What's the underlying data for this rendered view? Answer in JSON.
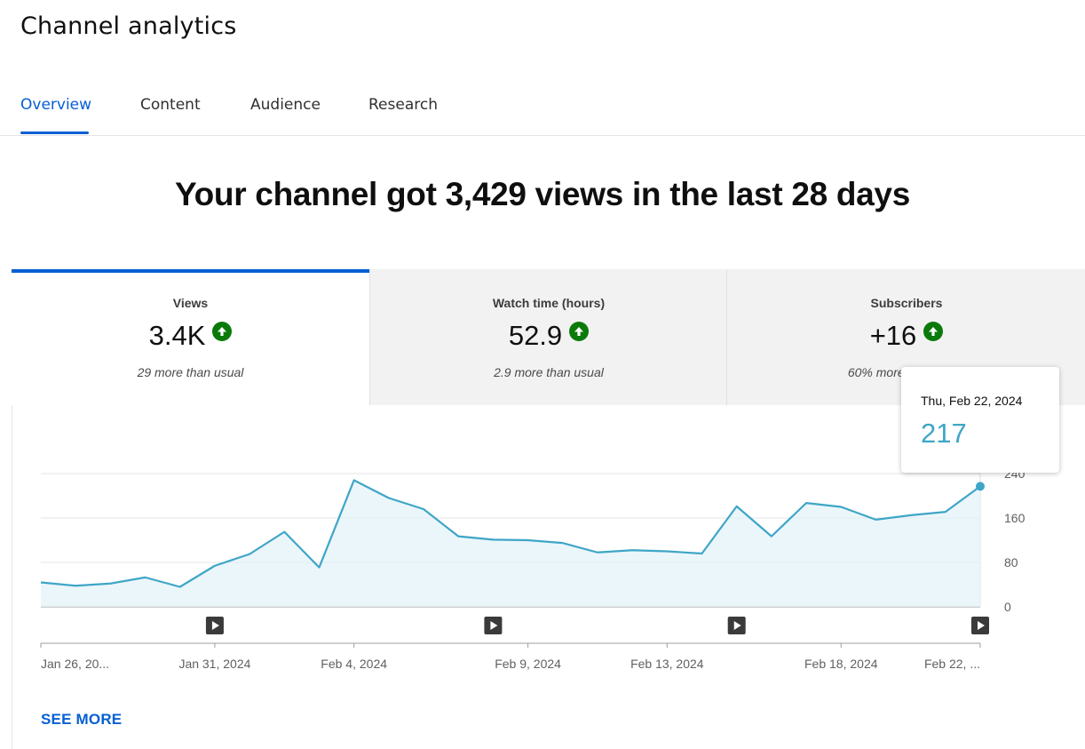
{
  "page": {
    "title": "Channel analytics"
  },
  "tabs": [
    {
      "label": "Overview",
      "active": true
    },
    {
      "label": "Content"
    },
    {
      "label": "Audience"
    },
    {
      "label": "Research"
    }
  ],
  "headline": "Your channel got 3,429 views in the last 28 days",
  "metrics": [
    {
      "label": "Views",
      "value": "3.4K",
      "note": "29 more than usual",
      "trend": "up",
      "selected": true
    },
    {
      "label": "Watch time (hours)",
      "value": "52.9",
      "note": "2.9 more than usual",
      "trend": "up"
    },
    {
      "label": "Subscribers",
      "value": "+16",
      "note": "60% more than usual",
      "trend": "up"
    }
  ],
  "tooltip": {
    "date": "Thu, Feb 22, 2024",
    "value": "217"
  },
  "see_more": "SEE MORE",
  "colors": {
    "accent": "#065fd4",
    "line": "#3ea6c7",
    "fill": "#e3f2f9",
    "trend_up": "#0b7a0b"
  },
  "chart_data": {
    "type": "area",
    "x": [
      "2024-01-26",
      "2024-01-27",
      "2024-01-28",
      "2024-01-29",
      "2024-01-30",
      "2024-01-31",
      "2024-02-01",
      "2024-02-02",
      "2024-02-03",
      "2024-02-04",
      "2024-02-05",
      "2024-02-06",
      "2024-02-07",
      "2024-02-08",
      "2024-02-09",
      "2024-02-10",
      "2024-02-11",
      "2024-02-12",
      "2024-02-13",
      "2024-02-14",
      "2024-02-15",
      "2024-02-16",
      "2024-02-17",
      "2024-02-18",
      "2024-02-19",
      "2024-02-20",
      "2024-02-21",
      "2024-02-22"
    ],
    "values": [
      44,
      38,
      42,
      53,
      36,
      74,
      95,
      135,
      71,
      228,
      196,
      176,
      127,
      121,
      120,
      115,
      98,
      102,
      100,
      96,
      181,
      127,
      187,
      180,
      157,
      165,
      171,
      217
    ],
    "x_tick_labels": [
      {
        "x": "2024-01-26",
        "label": "Jan 26, 20..."
      },
      {
        "x": "2024-01-31",
        "label": "Jan 31, 2024"
      },
      {
        "x": "2024-02-04",
        "label": "Feb 4, 2024"
      },
      {
        "x": "2024-02-09",
        "label": "Feb 9, 2024"
      },
      {
        "x": "2024-02-13",
        "label": "Feb 13, 2024"
      },
      {
        "x": "2024-02-18",
        "label": "Feb 18, 2024"
      },
      {
        "x": "2024-02-22",
        "label": "Feb 22, ..."
      }
    ],
    "y_ticks": [
      0,
      80,
      160,
      240
    ],
    "ylim": [
      0,
      240
    ],
    "grid": true,
    "highlight": {
      "x": "2024-02-22",
      "value": 217
    },
    "video_markers": [
      "2024-01-31",
      "2024-02-08",
      "2024-02-15",
      "2024-02-22"
    ]
  }
}
